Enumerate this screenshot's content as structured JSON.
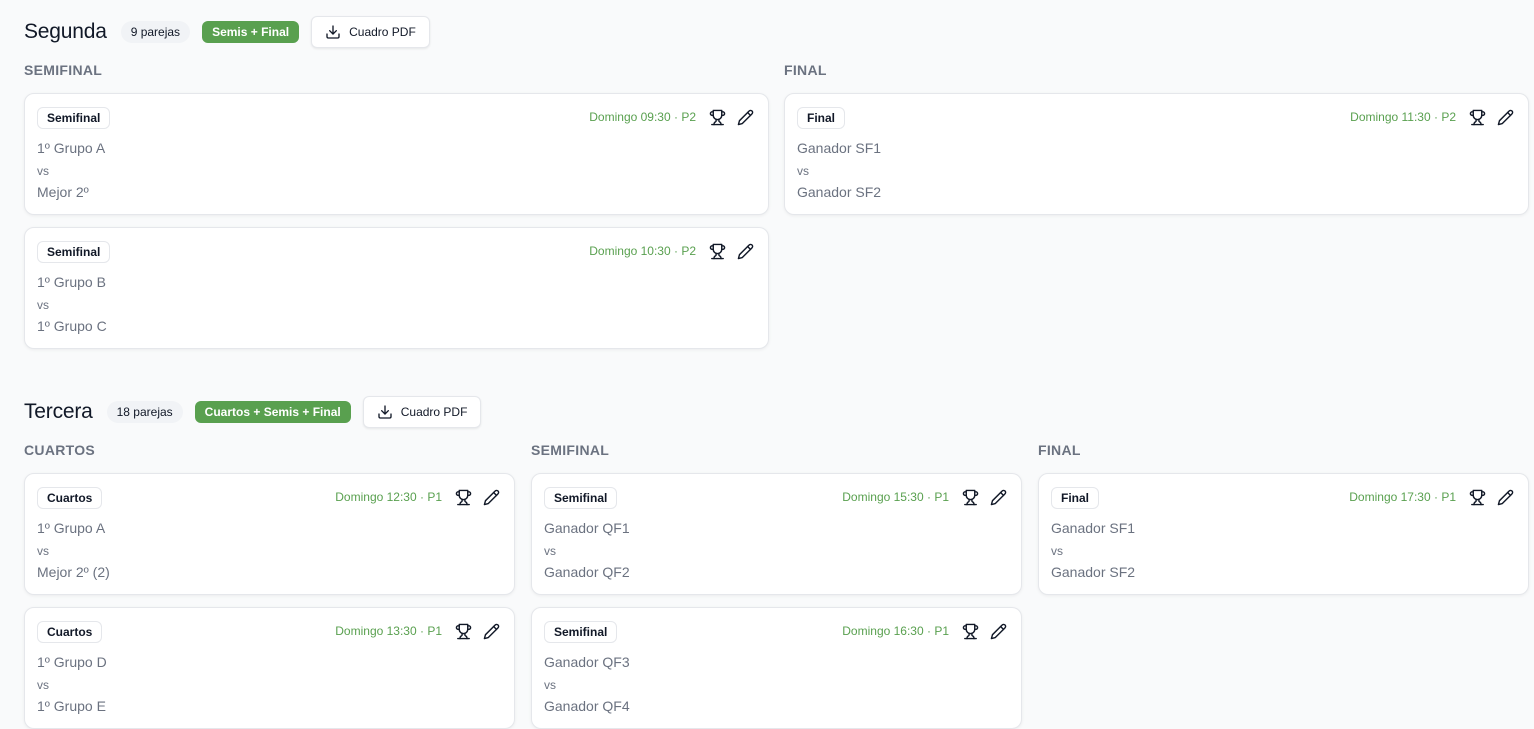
{
  "sections": [
    {
      "title": "Segunda",
      "count": "9 parejas",
      "format": "Semis + Final",
      "pdf_label": "Cuadro PDF",
      "columns": [
        {
          "title": "SEMIFINAL",
          "matches": [
            {
              "round": "Semifinal",
              "schedule": "Domingo 09:30 · P2",
              "team1": "1º Grupo A",
              "vs": "vs",
              "team2": "Mejor 2º"
            },
            {
              "round": "Semifinal",
              "schedule": "Domingo 10:30 · P2",
              "team1": "1º Grupo B",
              "vs": "vs",
              "team2": "1º Grupo C"
            }
          ]
        },
        {
          "title": "FINAL",
          "matches": [
            {
              "round": "Final",
              "schedule": "Domingo 11:30 · P2",
              "team1": "Ganador SF1",
              "vs": "vs",
              "team2": "Ganador SF2"
            }
          ]
        }
      ]
    },
    {
      "title": "Tercera",
      "count": "18 parejas",
      "format": "Cuartos + Semis + Final",
      "pdf_label": "Cuadro PDF",
      "columns": [
        {
          "title": "CUARTOS",
          "matches": [
            {
              "round": "Cuartos",
              "schedule": "Domingo 12:30 · P1",
              "team1": "1º Grupo A",
              "vs": "vs",
              "team2": "Mejor 2º (2)"
            },
            {
              "round": "Cuartos",
              "schedule": "Domingo 13:30 · P1",
              "team1": "1º Grupo D",
              "vs": "vs",
              "team2": "1º Grupo E"
            }
          ]
        },
        {
          "title": "SEMIFINAL",
          "matches": [
            {
              "round": "Semifinal",
              "schedule": "Domingo 15:30 · P1",
              "team1": "Ganador QF1",
              "vs": "vs",
              "team2": "Ganador QF2"
            },
            {
              "round": "Semifinal",
              "schedule": "Domingo 16:30 · P1",
              "team1": "Ganador QF3",
              "vs": "vs",
              "team2": "Ganador QF4"
            }
          ]
        },
        {
          "title": "FINAL",
          "matches": [
            {
              "round": "Final",
              "schedule": "Domingo 17:30 · P1",
              "team1": "Ganador SF1",
              "vs": "vs",
              "team2": "Ganador SF2"
            }
          ]
        }
      ]
    }
  ],
  "icons": {
    "download": "download-icon",
    "trophy": "trophy-icon",
    "edit": "pencil-icon"
  },
  "colors": {
    "accent_green": "#59a04f",
    "muted_text": "#6b7280",
    "card_border": "#e5e7eb"
  }
}
